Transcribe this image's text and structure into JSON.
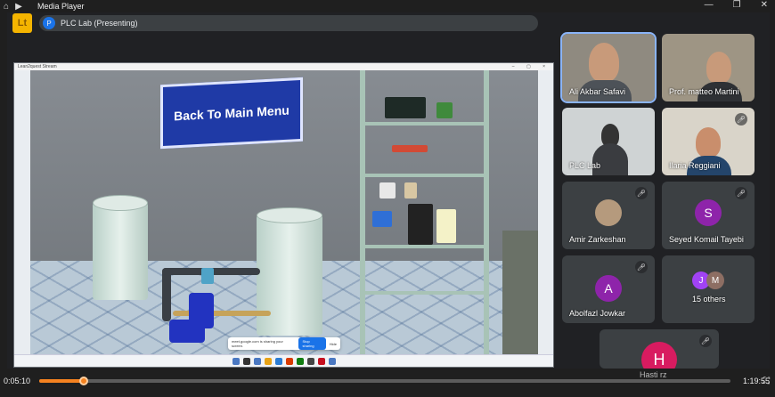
{
  "window": {
    "title": "Media Player",
    "controls": {
      "minimize": "—",
      "restore": "❐",
      "close": "✕"
    },
    "icons": [
      "home-icon",
      "play-circle-icon"
    ]
  },
  "meeting": {
    "app_badge": "Lt",
    "presenter_avatar": "P",
    "presenting_label": "PLC Lab (Presenting)"
  },
  "share": {
    "window_title": "Lean2quest Stream",
    "sign_text": "Back To Main Menu",
    "banner_text": "meet.google.com is sharing your screen.",
    "stop_button": "Stop sharing",
    "hide_button": "Hide"
  },
  "participants": [
    {
      "name": "Ali Akbar Safavi",
      "type": "video",
      "muted": false,
      "active": true
    },
    {
      "name": "Prof. matteo Martini",
      "type": "video",
      "muted": false
    },
    {
      "name": "PLC Lab",
      "type": "video",
      "muted": false
    },
    {
      "name": "Ilaria Reggiani",
      "type": "video",
      "muted": true
    },
    {
      "name": "Amir Zarkeshan",
      "type": "photo",
      "muted": true
    },
    {
      "name": "Seyed Komail Tayebi",
      "type": "avatar",
      "initial": "S",
      "color": "#8e24aa",
      "muted": true
    },
    {
      "name": "Abolfazl Jowkar",
      "type": "avatar",
      "initial": "A",
      "color": "#8e24aa",
      "muted": true
    },
    {
      "name": "15 others",
      "type": "group",
      "initials": [
        "J",
        "M"
      ],
      "colors": [
        "#a142f4",
        "#8d6e63"
      ]
    },
    {
      "name": "Hasti rz",
      "type": "avatar",
      "initial": "H",
      "color": "#d81b60",
      "muted": true
    }
  ],
  "player": {
    "current_time": "0:05:10",
    "total_time": "1:19:55",
    "progress": 0.065
  },
  "colors": {
    "accent": "#f58220",
    "highlight": "#8ab4f8"
  }
}
